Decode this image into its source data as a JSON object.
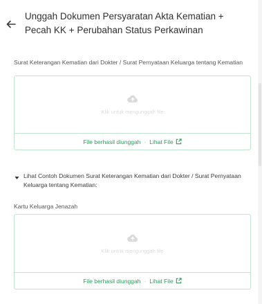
{
  "header": {
    "title": "Unggah Dokumen Persyaratan Akta Kematian + Pecah KK + Perubahan Status Perkawinan",
    "back_icon": "arrow-left-icon"
  },
  "section1": {
    "label": "Surat Keterangan Kematian dari Dokter / Surat Pernyataan Keluarga tentang Kematian",
    "upload_hint": "Klik untuk mengunggah file",
    "status": "File berhasil diunggah",
    "separator": "·",
    "view_link": "Lihat File",
    "icon": "cloud-upload-icon"
  },
  "example": {
    "label": "Lihat Contoh Dokumen Surat Keterangan Kematian dari Dokter / Surat Pernyataan Keluarga tentang Kematian:",
    "icon": "caret-down-icon"
  },
  "section2": {
    "label": "Kartu Keluarga Jenazah",
    "upload_hint": "Klik untuk mengunggah file",
    "status": "File berhasil diunggah",
    "separator": "·",
    "view_link": "Lihat File",
    "icon": "cloud-upload-icon"
  },
  "colors": {
    "accent": "#2e9a5c",
    "border": "#bfe3cf",
    "icon_muted": "#dadada"
  }
}
